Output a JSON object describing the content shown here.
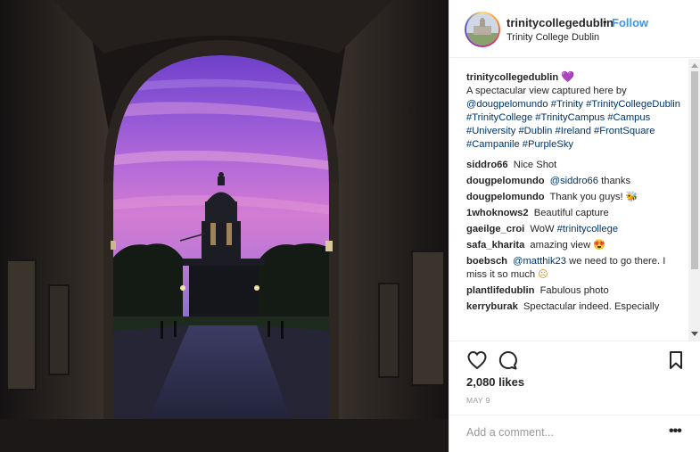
{
  "post": {
    "photo_alt": "",
    "account": {
      "username": "trinitycollegedublin",
      "separator": "•",
      "follow_label": "Follow",
      "location": "Trinity College Dublin"
    },
    "caption": {
      "username": "trinitycollegedublin",
      "emoji": "💜",
      "text_prefix": "A spectacular view captured here by",
      "mention": "@dougpelomundo",
      "hashtags": "#Trinity #TrinityCollegeDublin #TrinityCollege #TrinityCampus #Campus #University #Dublin #Ireland #FrontSquare #Campanile #PurpleSky"
    },
    "comments": [
      {
        "username": "siddro66",
        "text": "Nice Shot"
      },
      {
        "username": "dougpelomundo",
        "mention": "@siddro66",
        "text": "thanks"
      },
      {
        "username": "dougpelomundo",
        "text": "Thank you guys!",
        "emoji": "🐝"
      },
      {
        "username": "1whoknows2",
        "text": "Beautiful capture"
      },
      {
        "username": "gaeilge_croi",
        "text": "WoW",
        "mention": "#trinitycollege"
      },
      {
        "username": "safa_kharita",
        "text": "amazing view",
        "emoji": "😍"
      },
      {
        "username": "boebsch",
        "mention": "@matthik23",
        "text": "we need to go there. I miss it so much",
        "emoji": "☹"
      },
      {
        "username": "plantlifedublin",
        "text": "Fabulous photo"
      },
      {
        "username": "kerryburak",
        "text": "Spectacular indeed. Especially"
      }
    ],
    "likes": "2,080 likes",
    "date": "MAY 9",
    "add_comment_placeholder": "Add a comment...",
    "more_label": "•••",
    "icons": {
      "like": "heart-outline-icon",
      "comment": "speech-bubble-icon",
      "save": "bookmark-icon",
      "more": "ellipsis-icon"
    },
    "colors": {
      "follow": "#3897f0",
      "hashtag": "#003569",
      "text": "#262626",
      "muted": "#999999",
      "sky_purple": "#8a5ad0",
      "sky_pink": "#d98ad8"
    }
  }
}
